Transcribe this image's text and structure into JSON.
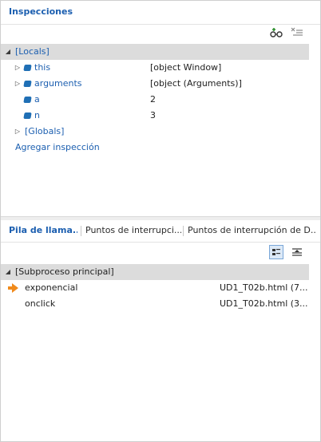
{
  "watch": {
    "title": "Inspecciones",
    "toolbar": {
      "add_icon": "add-watch-icon",
      "clear_icon": "clear-all-icon"
    },
    "locals_label": "[Locals]",
    "items": [
      {
        "name": "this",
        "value": "[object Window]",
        "expandable": true
      },
      {
        "name": "arguments",
        "value": "[object (Arguments)]",
        "expandable": true
      },
      {
        "name": "a",
        "value": "2",
        "expandable": false
      },
      {
        "name": "n",
        "value": "3",
        "expandable": false
      }
    ],
    "globals_label": "[Globals]",
    "add_watch_label": "Agregar inspección"
  },
  "bottom": {
    "tabs": [
      {
        "label": "Pila de llama...",
        "active": true
      },
      {
        "label": "Puntos de interrupci...",
        "active": false
      },
      {
        "label": "Puntos de interrupción de D...",
        "active": false
      }
    ],
    "thread_label": "[Subproceso principal]",
    "frames": [
      {
        "name": "exponencial",
        "location": "UD1_T02b.html (7...",
        "current": true
      },
      {
        "name": "onclick",
        "location": "UD1_T02b.html (3...",
        "current": false
      }
    ]
  },
  "colors": {
    "accent": "#1c5fb0",
    "header_bg": "#dcdcdc",
    "current_frame_arrow": "#f08a1c"
  }
}
